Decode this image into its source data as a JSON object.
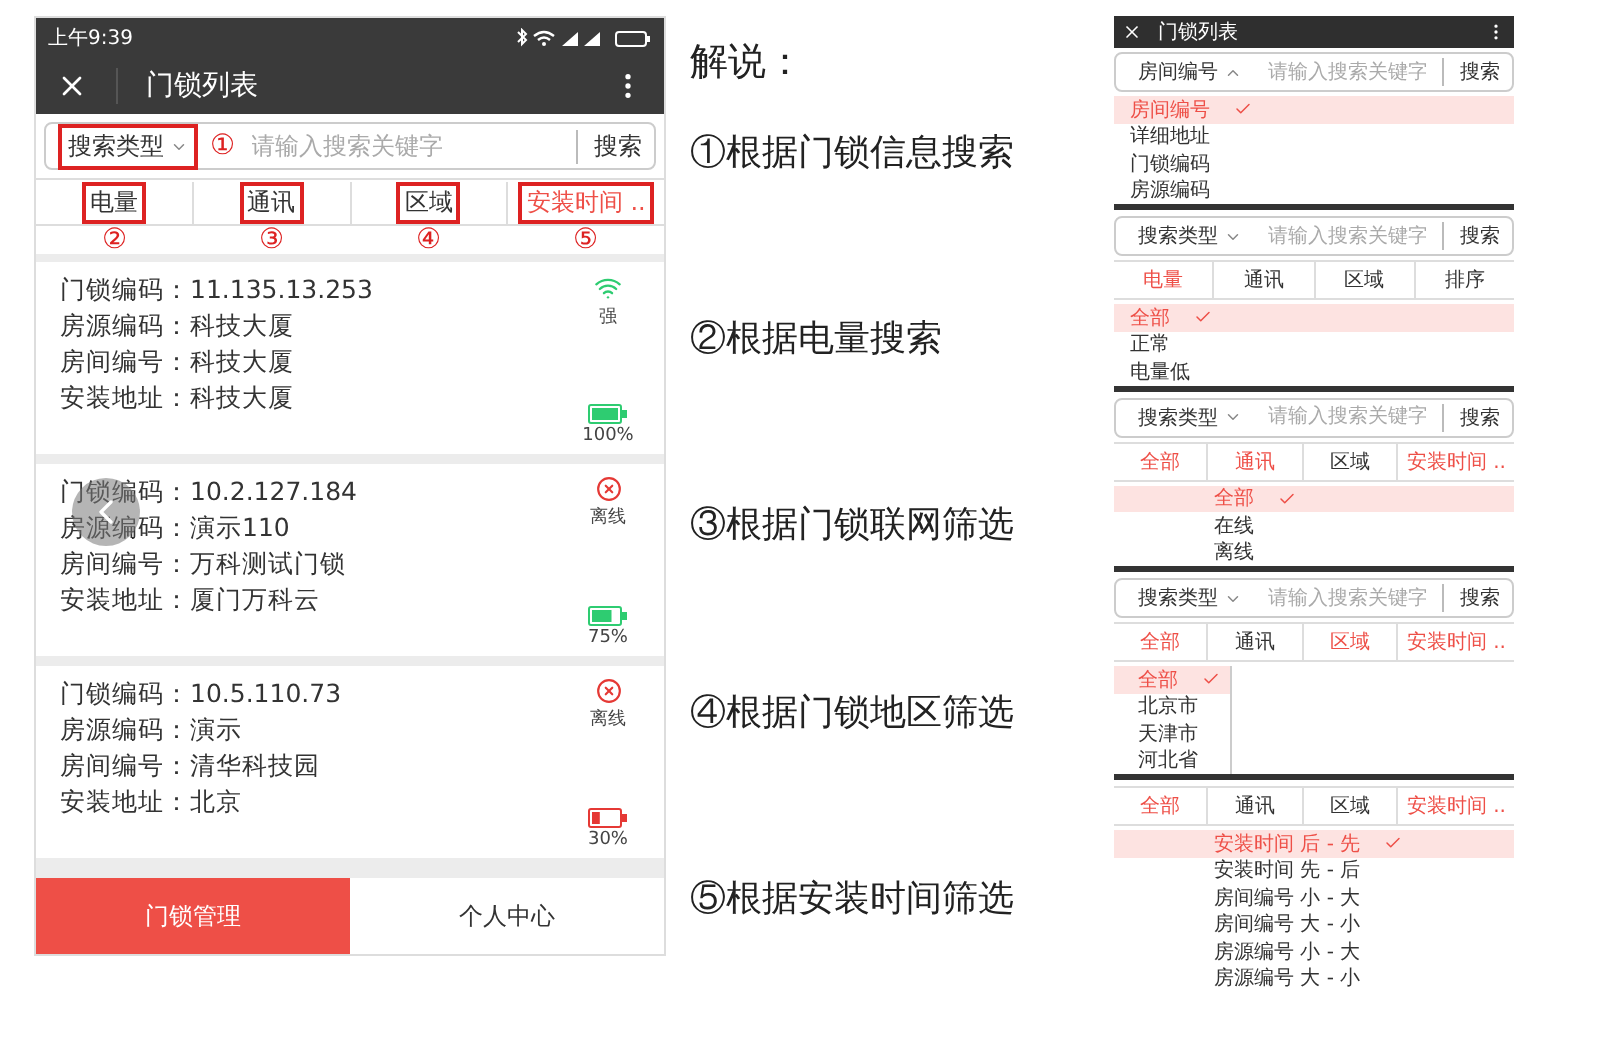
{
  "phone": {
    "status_bar": {
      "time": "上午9:39"
    },
    "title_bar": {
      "title": "门锁列表"
    },
    "search": {
      "type_label": "搜索类型",
      "annotation": "①",
      "placeholder": "请输入搜索关键字",
      "button": "搜索"
    },
    "filters": [
      {
        "label": "电量",
        "selected": false,
        "annotation": "②"
      },
      {
        "label": "通讯",
        "selected": false,
        "annotation": "③"
      },
      {
        "label": "区域",
        "selected": false,
        "annotation": "④"
      },
      {
        "label": "安装时间 ..",
        "selected": true,
        "annotation": "⑤"
      }
    ],
    "locks": [
      {
        "fields": [
          {
            "label": "门锁编码：",
            "value": "11.135.13.253"
          },
          {
            "label": "房源编码：",
            "value": "科技大厦"
          },
          {
            "label": "房间编号：",
            "value": "科技大厦"
          },
          {
            "label": "安装地址：",
            "value": "科技大厦"
          }
        ],
        "status": {
          "kind": "signal",
          "text": "强"
        },
        "battery": {
          "level": 1,
          "color": "#2ecc71",
          "text": "100%"
        }
      },
      {
        "fields": [
          {
            "label": "门锁编码：",
            "value": "10.2.127.184"
          },
          {
            "label": "房源编码：",
            "value": "演示110"
          },
          {
            "label": "房间编号：",
            "value": "万科测试门锁"
          },
          {
            "label": "安装地址：",
            "value": "厦门万科云"
          }
        ],
        "status": {
          "kind": "offline",
          "text": "离线"
        },
        "battery": {
          "level": 0.75,
          "color": "#2ecc71",
          "text": "75%"
        }
      },
      {
        "fields": [
          {
            "label": "门锁编码：",
            "value": "10.5.110.73"
          },
          {
            "label": "房源编码：",
            "value": "演示"
          },
          {
            "label": "房间编号：",
            "value": "清华科技园"
          },
          {
            "label": "安装地址：",
            "value": "北京"
          }
        ],
        "status": {
          "kind": "offline",
          "text": "离线"
        },
        "battery": {
          "level": 0.3,
          "color": "#e53935",
          "text": "30%"
        }
      }
    ],
    "nav": [
      {
        "label": "门锁管理",
        "selected": true
      },
      {
        "label": "个人中心",
        "selected": false
      }
    ]
  },
  "explanation": {
    "heading": "解说：",
    "items": [
      "①根据门锁信息搜索",
      "②根据电量搜索",
      "③根据门锁联网筛选",
      "④根据门锁地区筛选",
      "⑤根据安装时间筛选"
    ]
  },
  "examples": [
    {
      "kind": "plain",
      "title": "门锁列表",
      "search": {
        "type_label": "房间编号",
        "open": true,
        "placeholder": "请输入搜索关键字",
        "button": "搜索"
      },
      "options": [
        {
          "label": "房间编号",
          "selected": true
        },
        {
          "label": "详细地址",
          "selected": false
        },
        {
          "label": "门锁编码",
          "selected": false
        },
        {
          "label": "房源编码",
          "selected": false
        }
      ]
    },
    {
      "kind": "plain",
      "search": {
        "type_label": "搜索类型",
        "open": false,
        "placeholder": "请输入搜索关键字",
        "button": "搜索"
      },
      "filters": [
        {
          "label": "电量",
          "selected": true
        },
        {
          "label": "通讯",
          "selected": false
        },
        {
          "label": "区域",
          "selected": false
        },
        {
          "label": "排序",
          "selected": false
        }
      ],
      "options": [
        {
          "label": "全部",
          "selected": true
        },
        {
          "label": "正常",
          "selected": false
        },
        {
          "label": "电量低",
          "selected": false
        }
      ]
    },
    {
      "kind": "centered",
      "search": {
        "type_label": "搜索类型",
        "open": false,
        "placeholder": "请输入搜索关键字",
        "button": "搜索"
      },
      "filters": [
        {
          "label": "全部",
          "selected": true
        },
        {
          "label": "通讯",
          "selected": true
        },
        {
          "label": "区域",
          "selected": false
        },
        {
          "label": "安装时间 ..",
          "selected": true
        }
      ],
      "options": [
        {
          "label": "全部",
          "selected": true
        },
        {
          "label": "在线",
          "selected": false
        },
        {
          "label": "离线",
          "selected": false
        }
      ]
    },
    {
      "kind": "sidebar",
      "search": {
        "type_label": "搜索类型",
        "open": false,
        "placeholder": "请输入搜索关键字",
        "button": "搜索"
      },
      "filters": [
        {
          "label": "全部",
          "selected": true
        },
        {
          "label": "通讯",
          "selected": false
        },
        {
          "label": "区域",
          "selected": true
        },
        {
          "label": "安装时间 ..",
          "selected": true
        }
      ],
      "options": [
        {
          "label": "全部",
          "selected": true
        },
        {
          "label": "北京市",
          "selected": false
        },
        {
          "label": "天津市",
          "selected": false
        },
        {
          "label": "河北省",
          "selected": false
        }
      ]
    },
    {
      "kind": "centered",
      "filters": [
        {
          "label": "全部",
          "selected": true
        },
        {
          "label": "通讯",
          "selected": false
        },
        {
          "label": "区域",
          "selected": false
        },
        {
          "label": "安装时间 ..",
          "selected": true
        }
      ],
      "options": [
        {
          "label": "安装时间 后 - 先",
          "selected": true
        },
        {
          "label": "安装时间 先 - 后",
          "selected": false
        },
        {
          "label": "房间编号 小 - 大",
          "selected": false
        },
        {
          "label": "房间编号 大 - 小",
          "selected": false
        },
        {
          "label": "房源编号 小 - 大",
          "selected": false
        },
        {
          "label": "房源编号 大 - 小",
          "selected": false
        }
      ]
    }
  ]
}
